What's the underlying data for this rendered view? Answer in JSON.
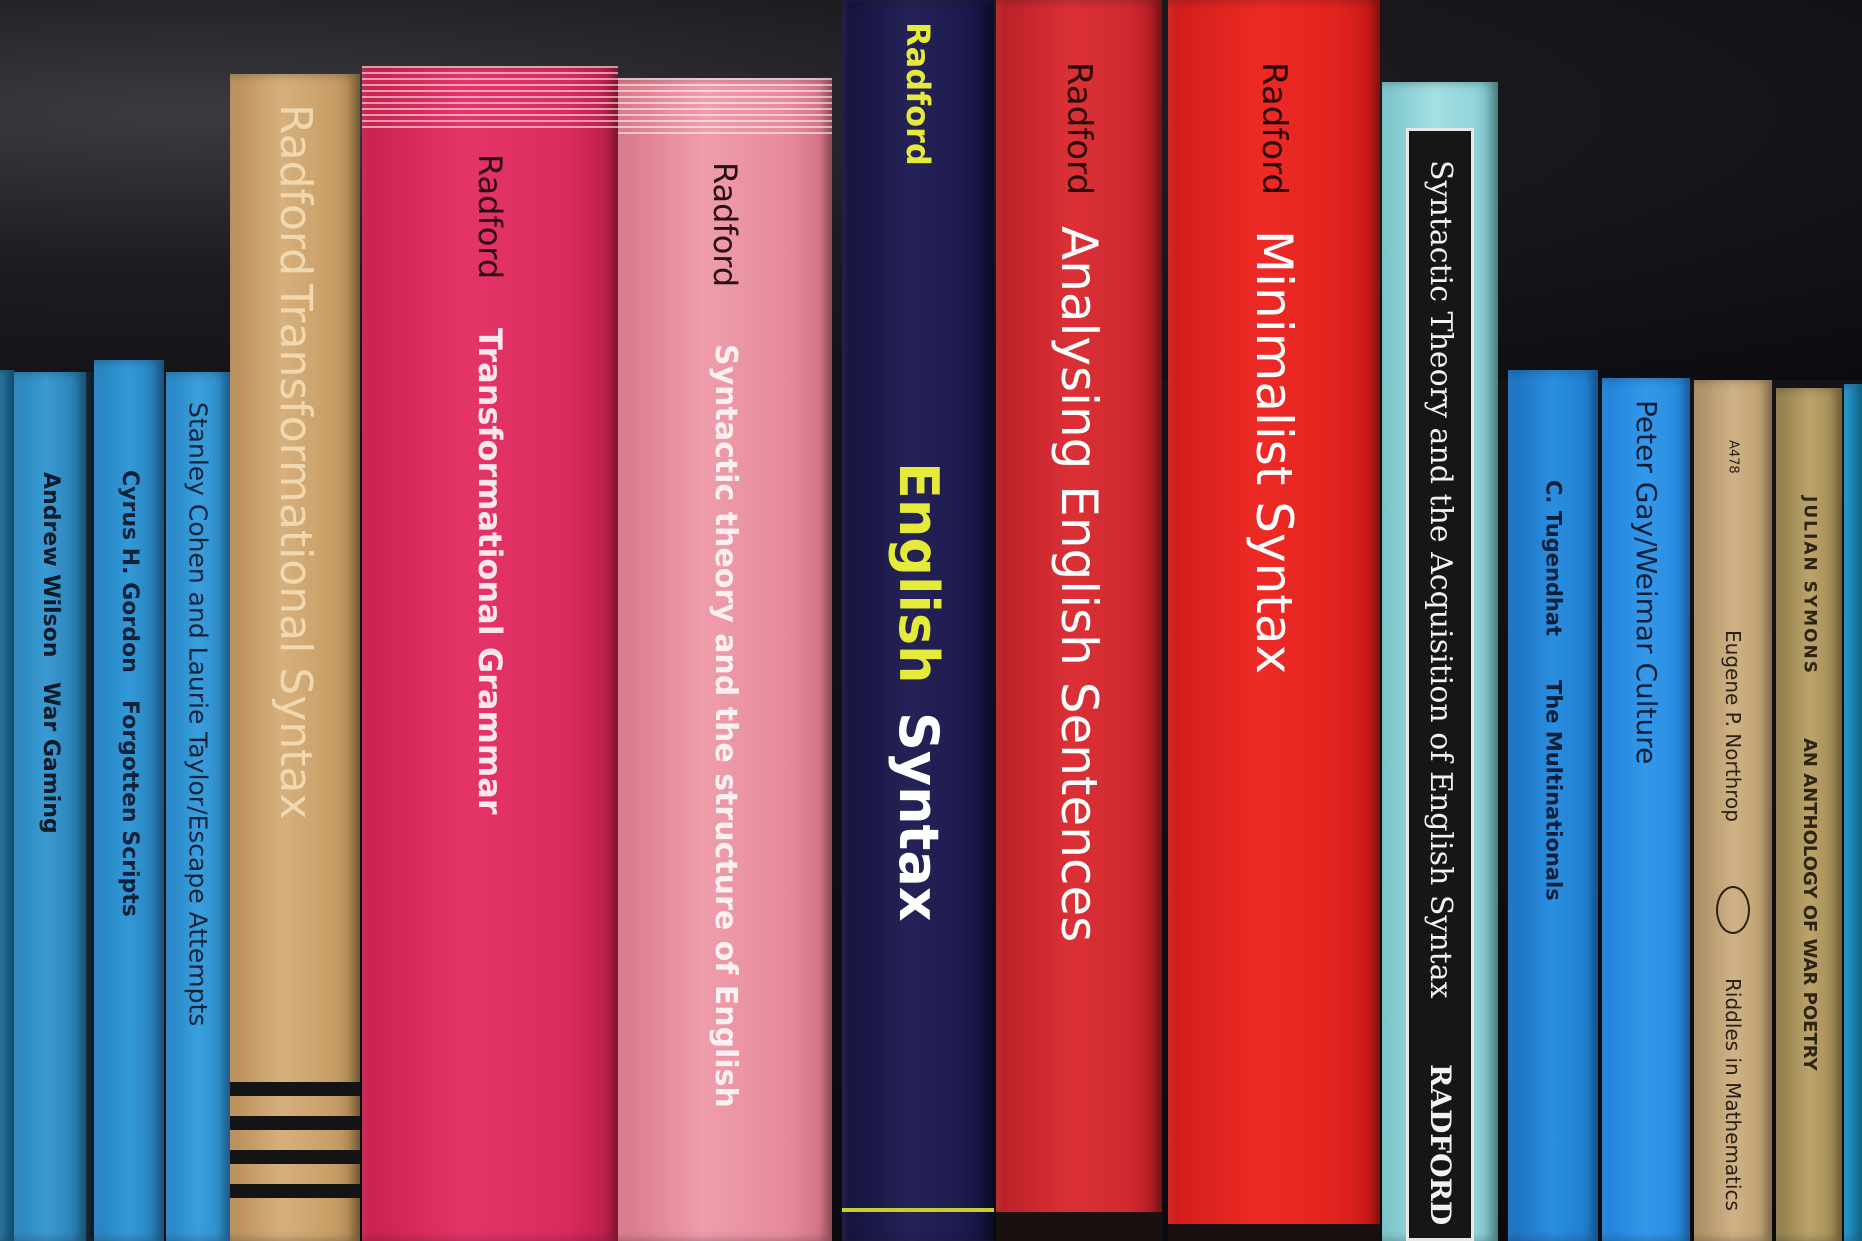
{
  "books": [
    {
      "id": "andrew-wilson",
      "author": "Andrew Wilson",
      "title": "War Gaming",
      "color": "#2f8fc8"
    },
    {
      "id": "cyrus-gordon",
      "author": "Cyrus H. Gordon",
      "title": "Forgotten Scripts",
      "color": "#2a8ccd"
    },
    {
      "id": "stanley-cohen",
      "author": "",
      "title": "Stanley Cohen and Laurie Taylor/Escape Attempts",
      "color": "#2a90d0"
    },
    {
      "id": "radford-transformational-syntax",
      "author": "Radford",
      "title": "Transformational Syntax",
      "color": "#c9a26f"
    },
    {
      "id": "radford-transformational-grammar",
      "author": "Radford",
      "title": "Transformational Grammar",
      "color": "#dd2e61"
    },
    {
      "id": "radford-syntactic-theory",
      "author": "Radford",
      "title": "Syntactic theory and the structure of English",
      "color": "#e68b9a"
    },
    {
      "id": "radford-english-syntax",
      "author": "Radford",
      "title_part1": "English",
      "title_part2": "Syntax",
      "color": "#1c1a4d",
      "accent": "#e6ea3a"
    },
    {
      "id": "radford-analysing",
      "author": "Radford",
      "title": "Analysing English Sentences",
      "color": "#d32a2f"
    },
    {
      "id": "radford-minimalist",
      "author": "Radford",
      "title": "Minimalist Syntax",
      "color": "#e2231f"
    },
    {
      "id": "radford-acquisition",
      "author": "RADFORD",
      "title": "Syntactic Theory and the Acquisition of English Syntax",
      "color": "#8fd3d8"
    },
    {
      "id": "tugendhat",
      "author": "C. Tugendhat",
      "title": "The Multinationals",
      "color": "#1f7fd3"
    },
    {
      "id": "peter-gay",
      "author": "",
      "title": "Peter Gay/Weimar Culture",
      "color": "#2a8ee0"
    },
    {
      "id": "northrop",
      "code": "A478",
      "author": "Eugene P. Northrop",
      "title": "Riddles in Mathematics",
      "color": "#c3a77a"
    },
    {
      "id": "julian-symons",
      "author": "JULIAN SYMONS",
      "title": "AN ANTHOLOGY OF WAR POETRY",
      "color": "#b49a63"
    }
  ]
}
